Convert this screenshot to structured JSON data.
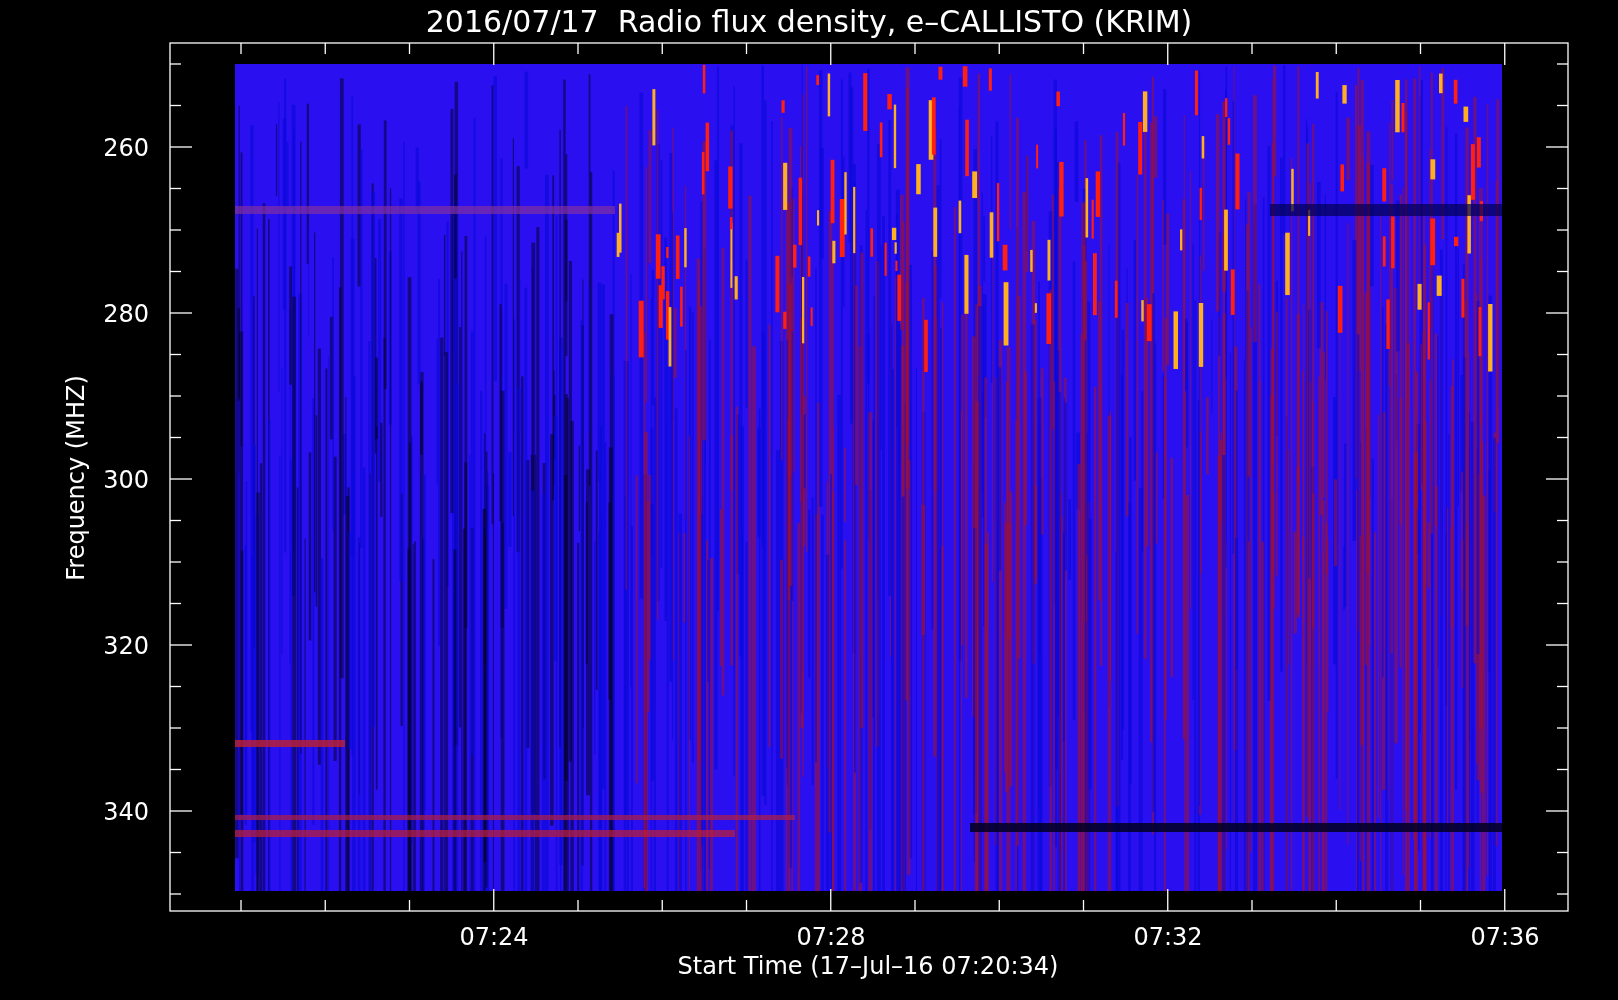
{
  "plot": {
    "title": "2016/07/17  Radio flux density, e–CALLISTO (KRIM)",
    "ylabel": "Frequency (MHZ)",
    "yticks": [
      "260",
      "280",
      "300",
      "320",
      "340"
    ],
    "xticks": [
      "07:24",
      "07:28",
      "07:32",
      "07:36"
    ],
    "xlabel": "Start Time (17–Jul–16 07:20:34)"
  }
}
